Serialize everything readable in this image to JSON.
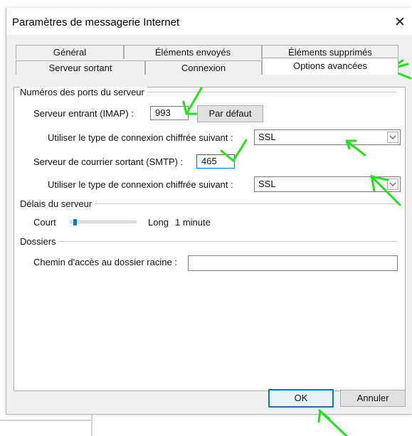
{
  "dialog": {
    "title": "Paramètres de messagerie Internet",
    "close_glyph": "✕"
  },
  "tabs": {
    "row1": [
      "Général",
      "Éléments envoyés",
      "Éléments supprimés"
    ],
    "row2": [
      "Serveur sortant",
      "Connexion",
      "Options avancées"
    ],
    "active": "Options avancées"
  },
  "ports": {
    "group_title": "Numéros des ports du serveur",
    "incoming_label": "Serveur entrant (IMAP) :",
    "incoming_value": "993",
    "default_button": "Par défaut",
    "encryption_label_in": "Utiliser le type de connexion chiffrée suivant :",
    "encryption_value_in": "SSL",
    "outgoing_label": "Serveur de courrier sortant (SMTP) :",
    "outgoing_value": "465",
    "encryption_label_out": "Utiliser le type de connexion chiffrée suivant :",
    "encryption_value_out": "SSL"
  },
  "timeouts": {
    "group_title": "Délais du serveur",
    "short_label": "Court",
    "long_label": "Long",
    "value_text": "1 minute",
    "slider_fraction": 0.05
  },
  "folders": {
    "group_title": "Dossiers",
    "root_path_label": "Chemin d'accès au dossier racine :",
    "root_path_value": ""
  },
  "footer": {
    "ok": "OK",
    "cancel": "Annuler"
  },
  "colors": {
    "accent": "#0078d7",
    "annotation": "#22e01b"
  }
}
